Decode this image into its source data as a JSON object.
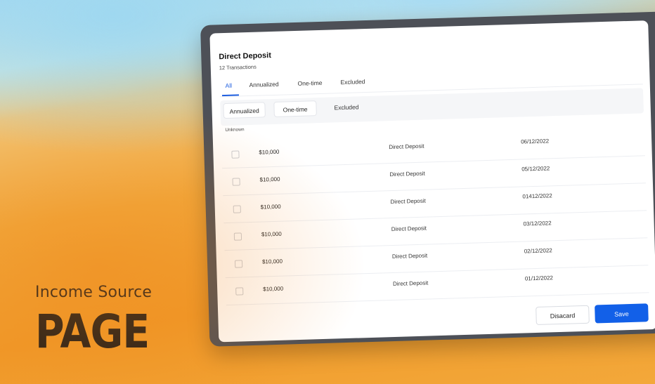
{
  "hero": {
    "subtitle": "Income Source",
    "title": "PAGE"
  },
  "panel": {
    "title": "Direct Deposit",
    "subtitle": "12 Transactions",
    "tabs": [
      "All",
      "Annualized",
      "One-time",
      "Excluded"
    ],
    "active_tab": "All",
    "filters": [
      "Annualized",
      "One-time",
      "Excluded"
    ],
    "section_label": "Unknown",
    "rows": [
      {
        "amount": "$10,000",
        "description": "Direct Deposit",
        "date": "06/12/2022"
      },
      {
        "amount": "$10,000",
        "description": "Direct Deposit",
        "date": "05/12/2022"
      },
      {
        "amount": "$10,000",
        "description": "Direct Deposit",
        "date": "01412/2022"
      },
      {
        "amount": "$10,000",
        "description": "Direct Deposit",
        "date": "03/12/2022"
      },
      {
        "amount": "$10,000",
        "description": "Direct Deposit",
        "date": "02/12/2022"
      },
      {
        "amount": "$10,000",
        "description": "Direct Deposit",
        "date": "01/12/2022"
      }
    ],
    "discard_label": "Disacard",
    "save_label": "Save"
  },
  "colors": {
    "accent": "#1260e8",
    "device_frame": "#4d5057"
  }
}
